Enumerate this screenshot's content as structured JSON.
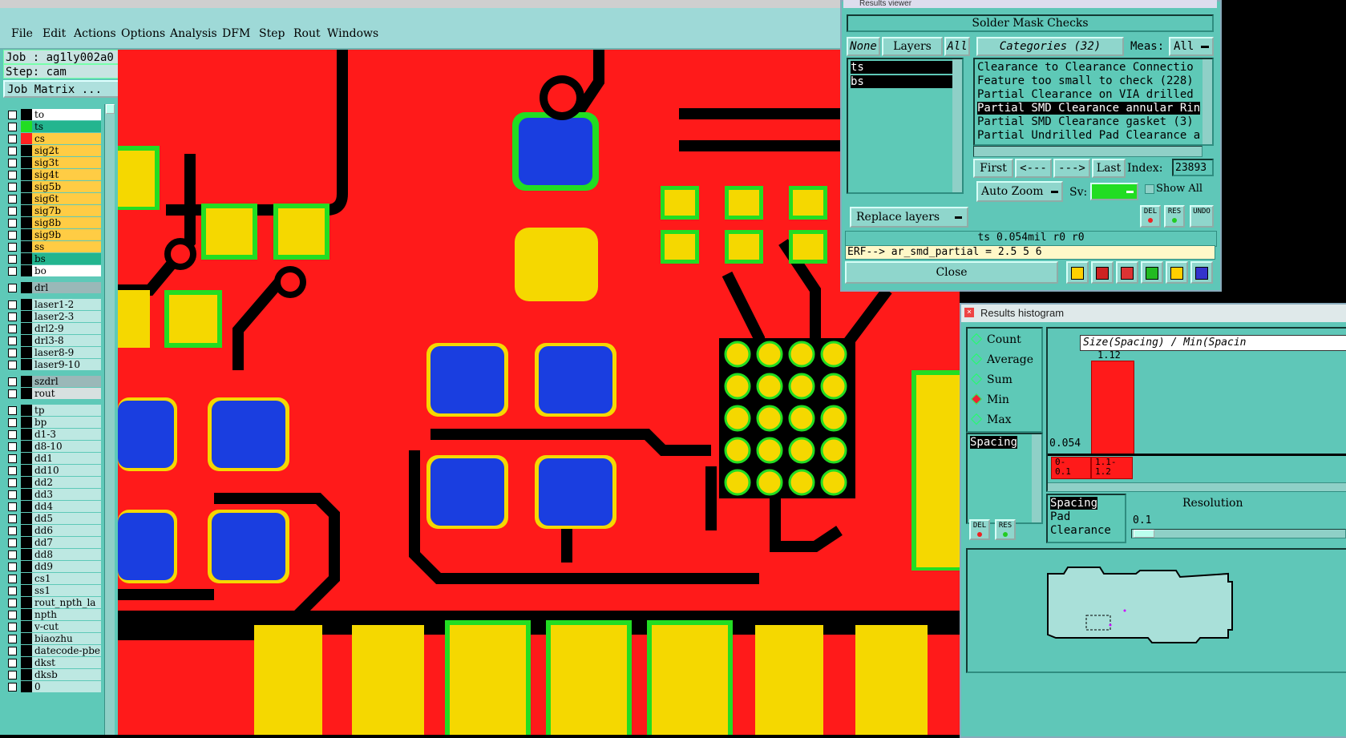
{
  "menubar": {
    "items": [
      "File",
      "Edit",
      "Actions",
      "Options",
      "Analysis",
      "DFM",
      "Step",
      "Rout",
      "Windows"
    ]
  },
  "left_panel": {
    "job_line": "Job : ag1ly002a0",
    "step_line": "Step: cam",
    "job_matrix_label": "Job Matrix ...",
    "layers": [
      {
        "name": "to",
        "color": "#ffffff",
        "swatch": "#000000"
      },
      {
        "name": "ts",
        "color": "#23b58f",
        "swatch": "#22dd22"
      },
      {
        "name": "cs",
        "color": "#ffcc44",
        "swatch": "#ff2222"
      },
      {
        "name": "sig2t",
        "color": "#ffcc44",
        "swatch": "#000000"
      },
      {
        "name": "sig3t",
        "color": "#ffcc44",
        "swatch": "#000000"
      },
      {
        "name": "sig4t",
        "color": "#ffcc44",
        "swatch": "#000000"
      },
      {
        "name": "sig5b",
        "color": "#ffcc44",
        "swatch": "#000000"
      },
      {
        "name": "sig6t",
        "color": "#ffcc44",
        "swatch": "#000000"
      },
      {
        "name": "sig7b",
        "color": "#ffcc44",
        "swatch": "#000000"
      },
      {
        "name": "sig8b",
        "color": "#ffcc44",
        "swatch": "#000000"
      },
      {
        "name": "sig9b",
        "color": "#ffcc44",
        "swatch": "#000000"
      },
      {
        "name": "ss",
        "color": "#ffcc44",
        "swatch": "#000000"
      },
      {
        "name": "bs",
        "color": "#23b58f",
        "swatch": "#000000"
      },
      {
        "name": "bo",
        "color": "#ffffff",
        "swatch": "#000000"
      }
    ],
    "drill_group": [
      {
        "name": "drl",
        "color": "#9ab8b8"
      }
    ],
    "laser_group": [
      {
        "name": "laser1-2",
        "color": "#bde8e2"
      },
      {
        "name": "laser2-3",
        "color": "#bde8e2"
      },
      {
        "name": "drl2-9",
        "color": "#bde8e2"
      },
      {
        "name": "drl3-8",
        "color": "#bde8e2"
      },
      {
        "name": "laser8-9",
        "color": "#bde8e2"
      },
      {
        "name": "laser9-10",
        "color": "#bde8e2"
      }
    ],
    "rout_group": [
      {
        "name": "szdrl",
        "color": "#9ab8b8"
      },
      {
        "name": "rout",
        "color": "#d8e0e0"
      }
    ],
    "misc_group": [
      {
        "name": "tp",
        "color": "#bde8e2"
      },
      {
        "name": "bp",
        "color": "#bde8e2"
      },
      {
        "name": "d1-3",
        "color": "#bde8e2"
      },
      {
        "name": "d8-10",
        "color": "#bde8e2"
      },
      {
        "name": "dd1",
        "color": "#bde8e2"
      },
      {
        "name": "dd10",
        "color": "#bde8e2"
      },
      {
        "name": "dd2",
        "color": "#bde8e2"
      },
      {
        "name": "dd3",
        "color": "#bde8e2"
      },
      {
        "name": "dd4",
        "color": "#bde8e2"
      },
      {
        "name": "dd5",
        "color": "#bde8e2"
      },
      {
        "name": "dd6",
        "color": "#bde8e2"
      },
      {
        "name": "dd7",
        "color": "#bde8e2"
      },
      {
        "name": "dd8",
        "color": "#bde8e2"
      },
      {
        "name": "dd9",
        "color": "#bde8e2"
      },
      {
        "name": "cs1",
        "color": "#bde8e2"
      },
      {
        "name": "ss1",
        "color": "#bde8e2"
      },
      {
        "name": "rout_npth_la",
        "color": "#bde8e2"
      },
      {
        "name": "npth",
        "color": "#bde8e2"
      },
      {
        "name": "v-cut",
        "color": "#bde8e2"
      },
      {
        "name": "biaozhu",
        "color": "#bde8e2"
      },
      {
        "name": "datecode-pbe",
        "color": "#bde8e2"
      },
      {
        "name": "dkst",
        "color": "#bde8e2"
      },
      {
        "name": "dksb",
        "color": "#bde8e2"
      },
      {
        "name": "0",
        "color": "#bde8e2"
      }
    ]
  },
  "results_viewer": {
    "window_title": "Results viewer",
    "header": "Solder Mask Checks",
    "btn_none": "None",
    "btn_layers": "Layers",
    "btn_all": "All",
    "categories_label": "Categories (32)",
    "meas_label": "Meas:",
    "meas_value": "All",
    "layer_list": [
      "ts",
      "bs"
    ],
    "category_list": [
      "Clearance to Clearance Connectio",
      "Feature too small to check (228)",
      "Partial Clearance on VIA drilled",
      "Partial SMD Clearance annular Rin",
      "Partial SMD Clearance gasket (3)",
      "Partial Undrilled Pad Clearance a"
    ],
    "selected_category_index": 3,
    "btn_first": "First",
    "btn_prev": "<---",
    "btn_next": "--->",
    "btn_last": "Last",
    "index_label": "Index:",
    "index_value": "23893",
    "auto_zoom": "Auto Zoom",
    "sv_label": "Sv:",
    "show_all": "Show All",
    "replace_layers": "Replace layers",
    "del_label": "DEL",
    "res_label": "RES",
    "undo_label": "UNDO",
    "status_line": "ts 0.054mil  r0  r0",
    "erf_line": "ERF--> ar_smd_partial = 2.5 5 6",
    "close_label": "Close"
  },
  "histogram": {
    "window_title": "Results histogram",
    "radio_options": [
      "Count",
      "Average",
      "Sum",
      "Min",
      "Max"
    ],
    "selected_radio": "Min",
    "list_selected": "Spacing",
    "chart_title": "Size(Spacing) / Min(Spacin",
    "bar_top_value": "1.12",
    "bar_low_value": "0.054",
    "bin1_label": "0-\n0.1",
    "bin2_label": "1.1-\n1.2",
    "lower_list": [
      "Spacing",
      "Pad",
      "Clearance"
    ],
    "resolution_label": "Resolution",
    "resolution_value": "0.1",
    "del_label": "DEL",
    "res_label": "RES"
  },
  "colors": {
    "copper": "#ff1a1a",
    "pad": "#f5d800",
    "mask": "#22dd22",
    "via_blue": "#1a3ee0",
    "panel": "#5fc7b8"
  }
}
